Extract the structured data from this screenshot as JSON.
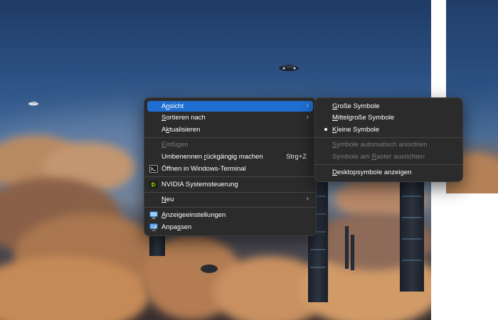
{
  "context_menu": {
    "items": [
      {
        "label_pre": "A",
        "label_u": "n",
        "label_post": "sicht",
        "has_submenu": true,
        "highlighted": true
      },
      {
        "label_pre": "",
        "label_u": "S",
        "label_post": "ortieren nach",
        "has_submenu": true
      },
      {
        "label_pre": "A",
        "label_u": "k",
        "label_post": "tualisieren"
      },
      {
        "label_pre": "",
        "label_u": "E",
        "label_post": "infügen",
        "disabled": true
      },
      {
        "label_pre": "Umbenennen ",
        "label_u": "r",
        "label_post": "ückgängig machen",
        "shortcut": "Strg+Z"
      },
      {
        "label": "Öffnen in Windows-Terminal",
        "icon": "terminal-icon"
      },
      {
        "label": "NVIDIA Systemsteuerung",
        "icon": "nvidia-icon"
      },
      {
        "label_pre": "",
        "label_u": "N",
        "label_post": "eu",
        "has_submenu": true
      },
      {
        "label_pre": "",
        "label_u": "A",
        "label_post": "nzeigeeinstellungen",
        "icon": "display-settings-icon"
      },
      {
        "label_pre": "Anpa",
        "label_u": "s",
        "label_post": "sen",
        "icon": "personalize-icon"
      }
    ]
  },
  "view_submenu": {
    "items": [
      {
        "label_pre": "",
        "label_u": "G",
        "label_post": "roße Symbole"
      },
      {
        "label_pre": "",
        "label_u": "M",
        "label_post": "ittelgroße Symbole"
      },
      {
        "label_pre": "",
        "label_u": "K",
        "label_post": "leine Symbole",
        "selected": true
      },
      {
        "label_pre": "",
        "label_u": "S",
        "label_post": "ymbole automatisch anordnen",
        "disabled": true
      },
      {
        "label_pre": "Symbole am ",
        "label_u": "R",
        "label_post": "aster ausrichten",
        "disabled": true
      },
      {
        "label_pre": "",
        "label_u": "D",
        "label_post": "esktopsymbole anzeigen"
      }
    ]
  },
  "colors": {
    "menu_bg": "#2b2b2b",
    "highlight": "#1e6fd1",
    "disabled_text": "#7a7a7a"
  }
}
